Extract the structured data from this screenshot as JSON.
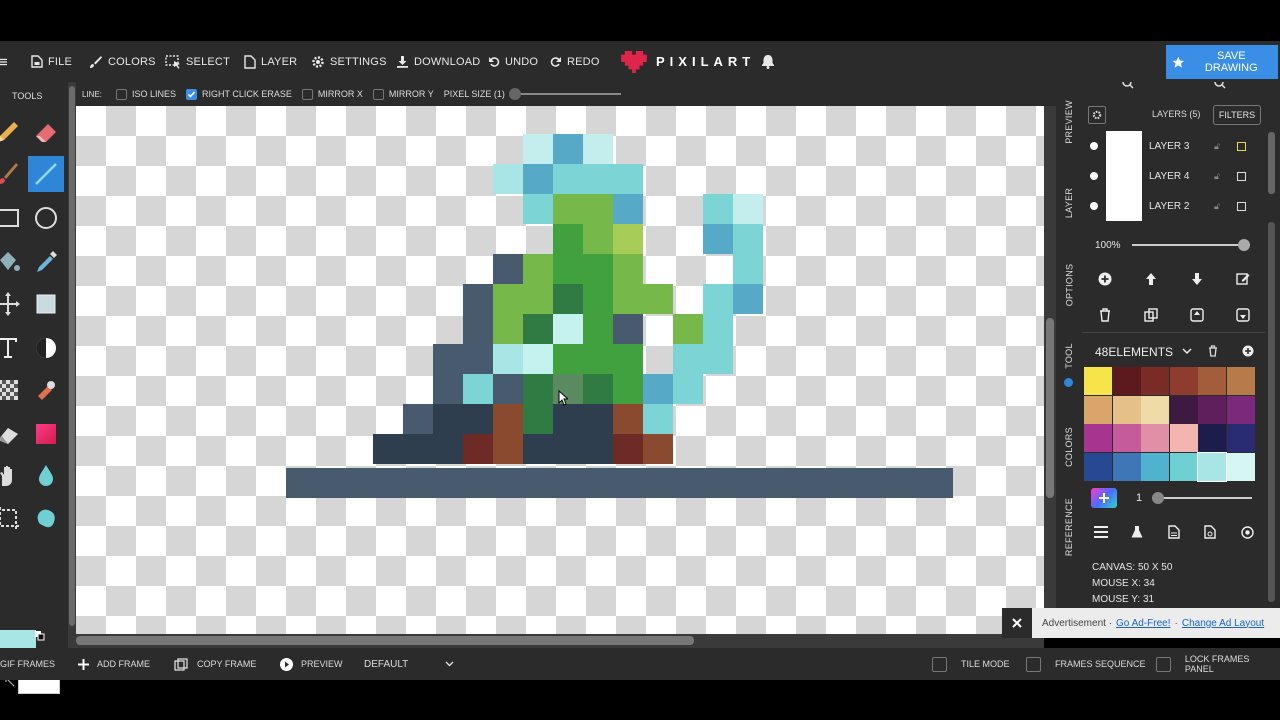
{
  "menu": {
    "items": [
      {
        "label": "FILE",
        "icon": "file-icon"
      },
      {
        "label": "COLORS",
        "icon": "brush-icon"
      },
      {
        "label": "SELECT",
        "icon": "select-icon"
      },
      {
        "label": "LAYER",
        "icon": "layer-icon"
      },
      {
        "label": "SETTINGS",
        "icon": "gear-icon"
      },
      {
        "label": "DOWNLOAD",
        "icon": "download-icon"
      },
      {
        "label": "UNDO",
        "icon": "undo-icon"
      },
      {
        "label": "REDO",
        "icon": "redo-icon"
      }
    ],
    "logo_text": "PIXILART",
    "save_label": "SAVE DRAWING"
  },
  "options": {
    "line_label": "LINE:",
    "iso_lines": "ISO LINES",
    "right_click_erase": "RIGHT CLICK ERASE",
    "mirror_x": "MIRROR X",
    "mirror_y": "MIRROR Y",
    "pixel_size": "PIXEL SIZE (1)",
    "checked": {
      "iso_lines": false,
      "right_click_erase": true,
      "mirror_x": false,
      "mirror_y": false
    }
  },
  "tools": {
    "label": "TOOLS",
    "items": [
      "pencil-icon",
      "eraser-icon",
      "brush-icon",
      "line-icon",
      "rectangle-icon",
      "circle-icon",
      "bucket-icon",
      "eyedropper-icon",
      "move-icon",
      "select-rect-icon",
      "text-icon",
      "shade-icon",
      "dither-icon",
      "stamp-icon",
      "gradient-icon",
      "gradient-swatch-icon",
      "hand-icon",
      "drop-icon",
      "crop-icon",
      "blob-icon"
    ],
    "active": "line-icon",
    "primary_color": "#a8e6e6",
    "secondary_color": "#ffffff"
  },
  "side_tabs": [
    "PREVIEW",
    "LAYER",
    "OPTIONS",
    "TOOL",
    "COLORS",
    "REFERENCE"
  ],
  "layers": {
    "title": "LAYERS (5)",
    "filters_label": "FILTERS",
    "items": [
      {
        "name": "LAYER 3"
      },
      {
        "name": "LAYER 4"
      },
      {
        "name": "LAYER 2"
      }
    ],
    "opacity": "100%"
  },
  "palette": {
    "name": "48ELEMENTS",
    "colors": [
      "#f7e34a",
      "#5c1a1f",
      "#7a2b26",
      "#8e3c2e",
      "#a45d3b",
      "#b77a4b",
      "#d9a56a",
      "#e5c088",
      "#efdba8",
      "#3d1a3f",
      "#5e1f5c",
      "#7b2a7b",
      "#a5358f",
      "#c65b9c",
      "#e08fa6",
      "#f2b6b0",
      "#1c1d4a",
      "#2a2c73",
      "#274893",
      "#3e76b6",
      "#4fb3d0",
      "#6fd0d4",
      "#a8e6e6",
      "#d6f6f3"
    ],
    "selected": 22,
    "brush_size": "1"
  },
  "info": {
    "canvas": "CANVAS: 50 X 50",
    "mouse_x": "MOUSE X: 34",
    "mouse_y": "MOUSE Y: 31"
  },
  "bottom": {
    "gif_frames": "GIF FRAMES",
    "add_frame": "ADD FRAME",
    "copy_frame": "COPY FRAME",
    "preview": "PREVIEW",
    "default": "DEFAULT",
    "tile_mode": "TILE MODE",
    "frames_sequence": "FRAMES SEQUENCE",
    "lock_frames": "LOCK FRAMES PANEL"
  },
  "ad": {
    "text": "Advertisement ·",
    "go_ad_free": "Go Ad-Free!",
    "sep": "·",
    "change_layout": "Change Ad Layout"
  },
  "art": {
    "palette_keys": {
      "A": "#c4eeee",
      "B": "#56aac8",
      "C": "#7cd4d4",
      "D": "#a8e6e6",
      "G": "#77b84a",
      "H": "#40a13e",
      "I": "#a8cc58",
      "J": "#2f7b43",
      "K": "#475a6e",
      "L": "#2f3e4e",
      "M": "#8a4a30",
      "N": "#6e2a24",
      "O": "#c4f2ee",
      "P": "#3a8a50",
      "Q": "#5a8a60"
    },
    "rows": [
      ".......................AB.A...........",
      "......................DBCCC...........",
      "......................CGGB.....CA.....",
      "........................HGI.....BC....",
      ".............KGHHG.............BC.....",
      "............KGGJHGG...........CB.....",
      "............KGJOHKKG..........C......",
      "...........KKDOHHH.GC.........",
      "..........KCKJJHHBC.............",
      ".........KLLMJLLMC..........",
      "........LLLNMLLLNM.........."
    ]
  }
}
